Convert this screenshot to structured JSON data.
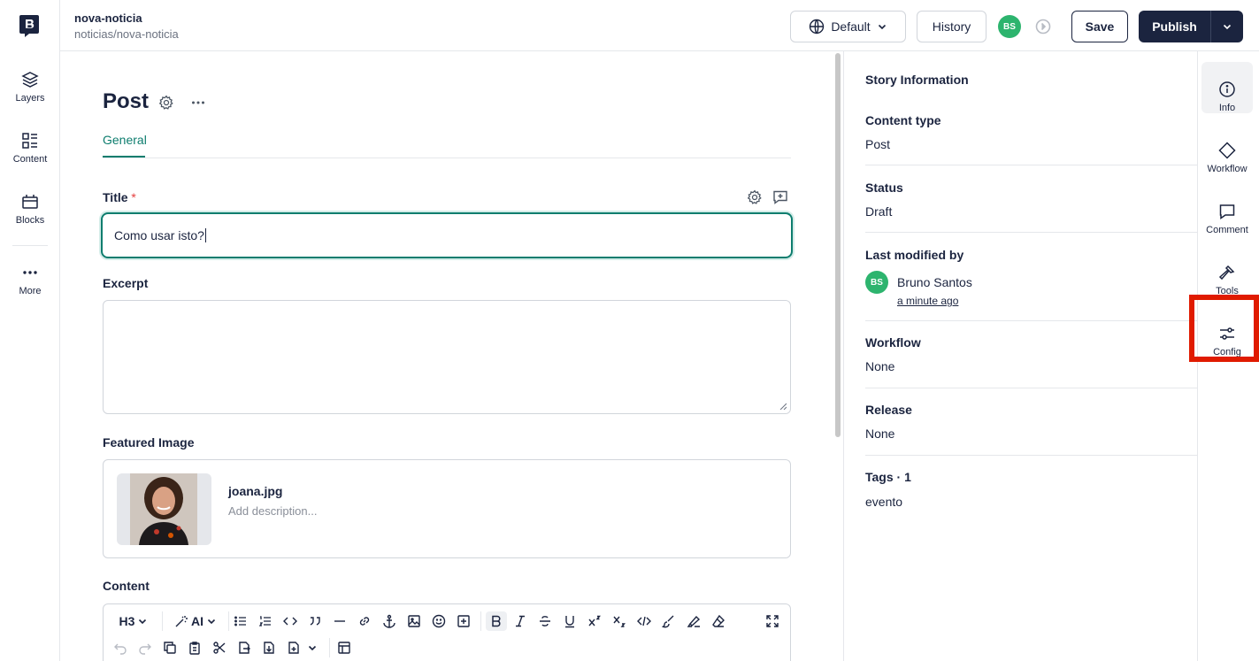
{
  "story": {
    "name": "nova-noticia",
    "slug": "noticias/nova-noticia"
  },
  "left_rail": [
    {
      "label": "Layers",
      "icon": "layers-icon"
    },
    {
      "label": "Content",
      "icon": "content-icon"
    },
    {
      "label": "Blocks",
      "icon": "blocks-icon"
    },
    {
      "label": "More",
      "icon": "more-icon"
    }
  ],
  "topbar": {
    "language": "Default",
    "history": "History",
    "user_initials": "BS",
    "save": "Save",
    "publish": "Publish"
  },
  "editor": {
    "heading": "Post",
    "tab": "General",
    "title_label": "Title",
    "title_required": "*",
    "title_value": "Como usar isto?",
    "excerpt_label": "Excerpt",
    "excerpt_value": "",
    "featured_label": "Featured Image",
    "image_name": "joana.jpg",
    "image_desc_placeholder": "Add description...",
    "content_label": "Content",
    "heading_level": "H3",
    "ai_label": "AI"
  },
  "info": {
    "heading": "Story Information",
    "content_type_label": "Content type",
    "content_type": "Post",
    "status_label": "Status",
    "status": "Draft",
    "modified_label": "Last modified by",
    "modifier_initials": "BS",
    "modifier_name": "Bruno Santos",
    "modified_time": "a minute ago",
    "workflow_label": "Workflow",
    "workflow": "None",
    "release_label": "Release",
    "release": "None",
    "tags_label": "Tags · 1",
    "tags": "evento"
  },
  "right_rail": [
    {
      "label": "Info",
      "icon": "info-icon",
      "active": true
    },
    {
      "label": "Workflow",
      "icon": "workflow-icon"
    },
    {
      "label": "Comment",
      "icon": "comment-icon"
    },
    {
      "label": "Tools",
      "icon": "tools-icon"
    },
    {
      "label": "Config",
      "icon": "config-icon"
    }
  ],
  "colors": {
    "accent": "#0d7d6e",
    "primary": "#1b243f",
    "avatar": "#2db46e",
    "highlight": "#e01b00"
  }
}
